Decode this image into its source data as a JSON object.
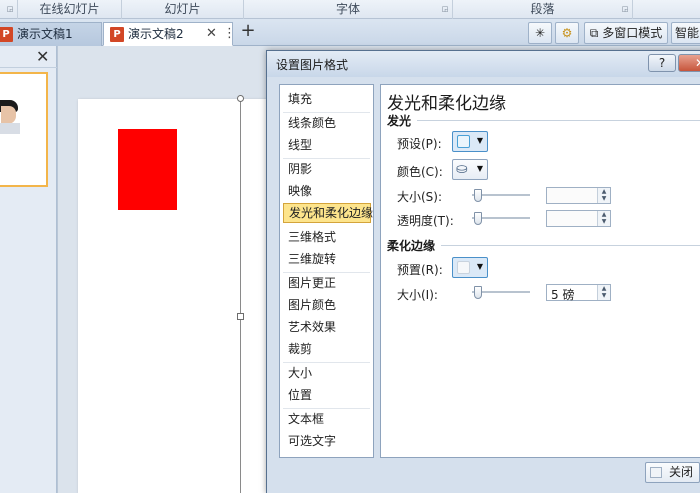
{
  "ribbon": {
    "groups": [
      {
        "label": ""
      },
      {
        "label": "在线幻灯片"
      },
      {
        "label": "幻灯片"
      },
      {
        "label": "字体"
      },
      {
        "label": "段落"
      }
    ]
  },
  "tabs": [
    {
      "label": "演示文稿1"
    },
    {
      "label": "演示文稿2"
    }
  ],
  "toolbar": {
    "add_tab": "+",
    "multi_window": "多窗口模式",
    "smart": "智能"
  },
  "thumbpane": {
    "close": "✕"
  },
  "dialog": {
    "title": "设置图片格式",
    "help": "?",
    "close_label": "关闭",
    "nav": [
      "填充",
      "线条颜色",
      "线型",
      "阴影",
      "映像",
      "发光和柔化边缘",
      "三维格式",
      "三维旋转",
      "图片更正",
      "图片颜色",
      "艺术效果",
      "裁剪",
      "大小",
      "位置",
      "文本框",
      "可选文字"
    ],
    "selected_nav": "发光和柔化边缘",
    "panel_title": "发光和柔化边缘",
    "glow": {
      "section": "发光",
      "preset_label": "预设(P):",
      "color_label": "颜色(C):",
      "size_label": "大小(S):",
      "transparency_label": "透明度(T):",
      "size_value": "",
      "transparency_value": ""
    },
    "soft_edges": {
      "section": "柔化边缘",
      "preset_label": "预置(R):",
      "size_label": "大小(I):",
      "size_value": "5 磅"
    }
  },
  "colors": {
    "shape_fill": "#ff0000",
    "selected_nav_bg": "#fde48c"
  }
}
